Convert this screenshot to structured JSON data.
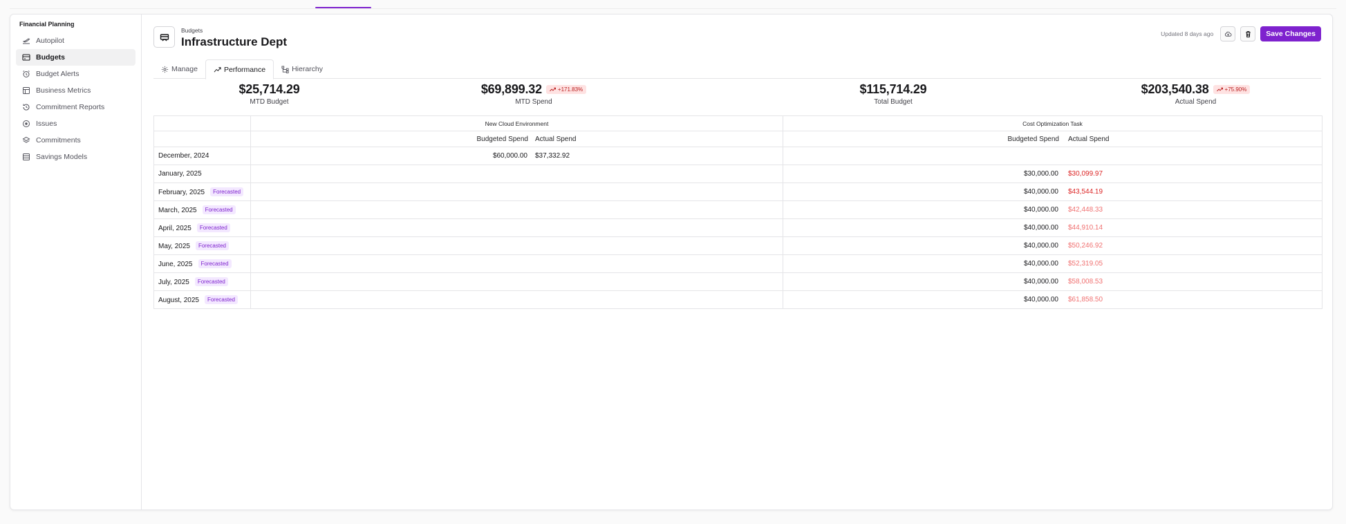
{
  "sidebar": {
    "title": "Financial Planning",
    "items": [
      {
        "label": "Autopilot",
        "icon": "autopilot-icon"
      },
      {
        "label": "Budgets",
        "icon": "budgets-icon",
        "active": true
      },
      {
        "label": "Budget Alerts",
        "icon": "budget-alerts-icon"
      },
      {
        "label": "Business Metrics",
        "icon": "business-metrics-icon"
      },
      {
        "label": "Commitment Reports",
        "icon": "commitment-reports-icon"
      },
      {
        "label": "Issues",
        "icon": "issues-icon"
      },
      {
        "label": "Commitments",
        "icon": "commitments-icon"
      },
      {
        "label": "Savings Models",
        "icon": "savings-models-icon"
      }
    ]
  },
  "header": {
    "breadcrumb": "Budgets",
    "title": "Infrastructure Dept",
    "updated": "Updated 8 days ago",
    "save_label": "Save Changes"
  },
  "tabs": [
    {
      "label": "Manage",
      "icon": "gear-icon"
    },
    {
      "label": "Performance",
      "icon": "performance-icon",
      "active": true
    },
    {
      "label": "Hierarchy",
      "icon": "hierarchy-icon"
    }
  ],
  "stats": [
    {
      "value": "$25,714.29",
      "label": "MTD Budget",
      "badge": ""
    },
    {
      "value": "$69,899.32",
      "label": "MTD Spend",
      "badge": "+171.83%"
    },
    {
      "value": "$115,714.29",
      "label": "Total Budget",
      "badge": ""
    },
    {
      "value": "$203,540.38",
      "label": "Actual Spend",
      "badge": "+75.90%"
    }
  ],
  "table": {
    "groups": [
      "New Cloud Environment",
      "Cost Optimization Task"
    ],
    "sub_headers": {
      "budgeted": "Budgeted Spend",
      "actual": "Actual Spend"
    },
    "forecast_label": "Forecasted",
    "rows": [
      {
        "month": "December, 2024",
        "forecast": false,
        "g1_budget": "$60,000.00",
        "g1_actual": "$37,332.92",
        "g2_budget": "",
        "g2_actual": "",
        "red": ""
      },
      {
        "month": "January, 2025",
        "forecast": false,
        "g1_budget": "",
        "g1_actual": "",
        "g2_budget": "$30,000.00",
        "g2_actual": "$30,099.97",
        "red": "strong"
      },
      {
        "month": "February, 2025",
        "forecast": true,
        "g1_budget": "",
        "g1_actual": "",
        "g2_budget": "$40,000.00",
        "g2_actual": "$43,544.19",
        "red": "strong"
      },
      {
        "month": "March, 2025",
        "forecast": true,
        "g1_budget": "",
        "g1_actual": "",
        "g2_budget": "$40,000.00",
        "g2_actual": "$42,448.33",
        "red": "soft"
      },
      {
        "month": "April, 2025",
        "forecast": true,
        "g1_budget": "",
        "g1_actual": "",
        "g2_budget": "$40,000.00",
        "g2_actual": "$44,910.14",
        "red": "soft"
      },
      {
        "month": "May, 2025",
        "forecast": true,
        "g1_budget": "",
        "g1_actual": "",
        "g2_budget": "$40,000.00",
        "g2_actual": "$50,246.92",
        "red": "soft"
      },
      {
        "month": "June, 2025",
        "forecast": true,
        "g1_budget": "",
        "g1_actual": "",
        "g2_budget": "$40,000.00",
        "g2_actual": "$52,319.05",
        "red": "soft"
      },
      {
        "month": "July, 2025",
        "forecast": true,
        "g1_budget": "",
        "g1_actual": "",
        "g2_budget": "$40,000.00",
        "g2_actual": "$58,008.53",
        "red": "soft"
      },
      {
        "month": "August, 2025",
        "forecast": true,
        "g1_budget": "",
        "g1_actual": "",
        "g2_budget": "$40,000.00",
        "g2_actual": "$61,858.50",
        "red": "soft"
      }
    ]
  },
  "colors": {
    "accent": "#7e22ce",
    "over_budget_strong": "#dc2626",
    "over_budget_soft": "#f07070",
    "badge_bg": "#fee2e2"
  }
}
